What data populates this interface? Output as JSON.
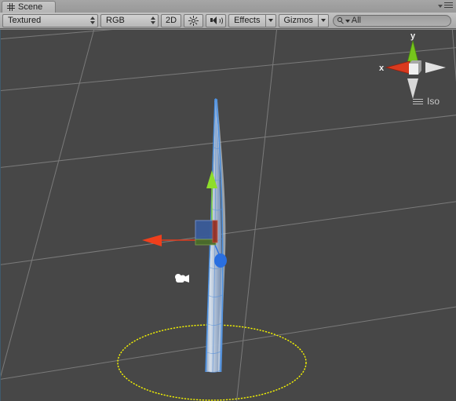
{
  "window": {
    "tab_label": "Scene",
    "tab_icon": "grid-hash-icon",
    "panel_menu_icon": "panel-menu-icon"
  },
  "toolbar": {
    "draw_mode": {
      "value": "Textured",
      "icon": "updown-arrows-icon"
    },
    "color_mode": {
      "value": "RGB",
      "icon": "updown-arrows-icon"
    },
    "toggle_2d": "2D",
    "lighting_icon": "sun-light-icon",
    "audio_icon": "speaker-audio-icon",
    "effects": {
      "label": "Effects",
      "dropdown_icon": "chevron-down-icon"
    },
    "gizmos": {
      "label": "Gizmos",
      "dropdown_icon": "chevron-down-icon"
    },
    "search": {
      "value": "All",
      "placeholder": "All",
      "icon": "search-magnifier-icon",
      "dropdown_icon": "chevron-down-icon"
    }
  },
  "viewport": {
    "background_color": "#474747",
    "grid_color": "#9a9a9a",
    "projection_label": "Iso",
    "projection_menu_icon": "lines-menu-icon",
    "axis_gizmo": {
      "x_label": "x",
      "y_label": "y",
      "x_color": "#d93a1e",
      "y_color": "#76c51c",
      "z_color": "#d8d8d8",
      "center_color": "#e8e8e8"
    },
    "move_gizmo": {
      "x_axis_color": "#e03a1c",
      "y_axis_color": "#7ed321",
      "z_axis_color": "#2a6fe0",
      "plane_xy_color": "#3a5c9a",
      "plane_xz_color": "#4a6b2a"
    },
    "selection": {
      "object_outline_color": "#4a90e2",
      "object_fill_color": "#c8d8ec"
    },
    "light_gizmo": {
      "shape": "ellipse",
      "color": "#f5f500"
    },
    "camera_gizmo": {
      "icon": "camera-icon",
      "color": "#ffffff"
    }
  }
}
